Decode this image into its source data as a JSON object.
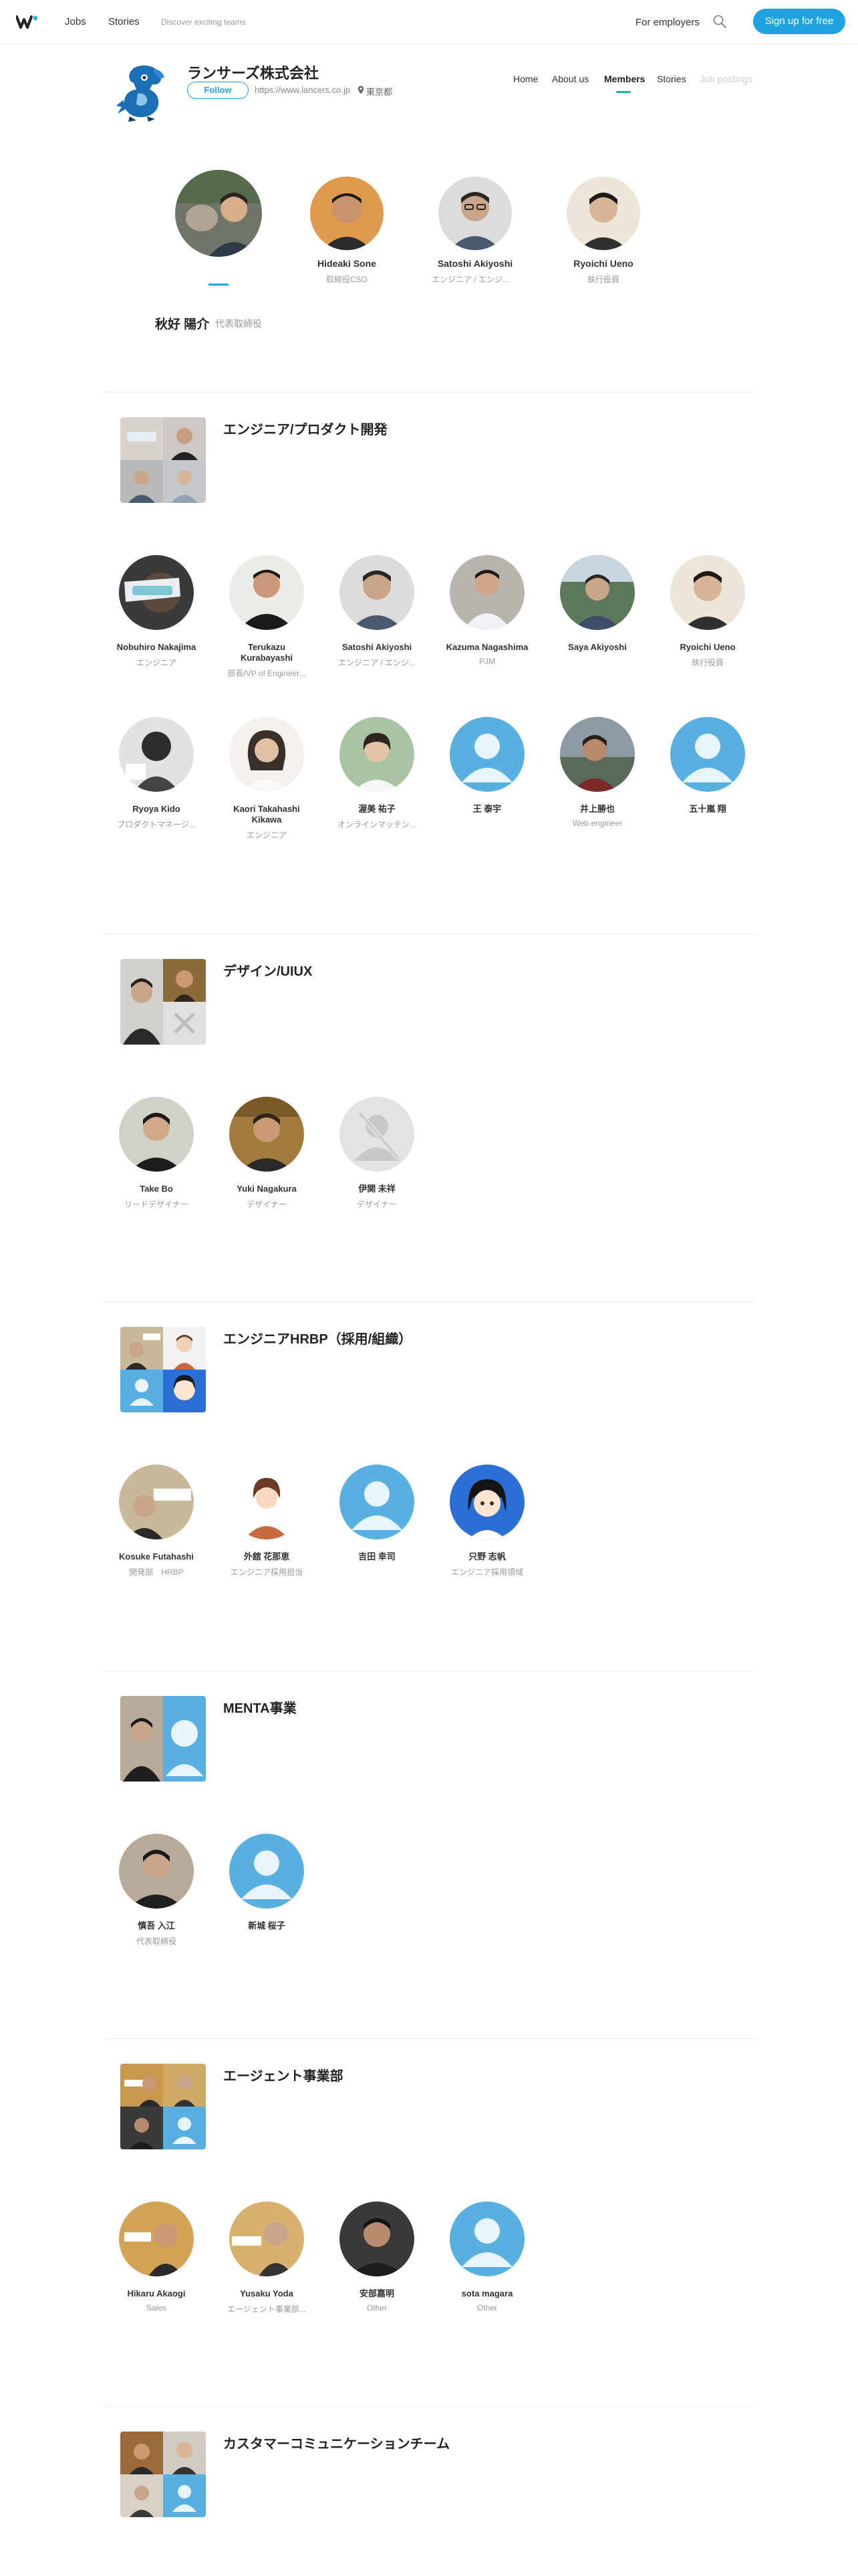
{
  "nav": {
    "jobs": "Jobs",
    "stories": "Stories",
    "tagline": "Discover exciting teams",
    "employers": "For employers",
    "signup": "Sign up for free"
  },
  "company": {
    "name": "ランサーズ株式会社",
    "follow": "Follow",
    "url": "https://www.lancers.co.jp",
    "location": "東京都",
    "tabs": [
      "Home",
      "About us",
      "Members",
      "Stories",
      "Job postings"
    ]
  },
  "featured": {
    "members": [
      {
        "name": "",
        "role": ""
      },
      {
        "name": "Hideaki Sone",
        "role": "取締役CSO"
      },
      {
        "name": "Satoshi Akiyoshi",
        "role": "エンジニア / エンジニアリ..."
      },
      {
        "name": "Ryoichi Ueno",
        "role": "執行役員"
      }
    ],
    "selected_name": "秋好 陽介",
    "selected_role": "代表取締役"
  },
  "sections": [
    {
      "title": "エンジニア/プロダクト開発",
      "members": [
        {
          "name": "Nobuhiro Nakajima",
          "role": "エンジニア"
        },
        {
          "name": "Terukazu Kurabayashi",
          "role": "部長/VP of Engineer..."
        },
        {
          "name": "Satoshi Akiyoshi",
          "role": "エンジニア / エンジ..."
        },
        {
          "name": "Kazuma Nagashima",
          "role": "PJM"
        },
        {
          "name": "Saya Akiyoshi",
          "role": ""
        },
        {
          "name": "Ryoichi Ueno",
          "role": "執行役員"
        },
        {
          "name": "Ryoya Kido",
          "role": "プロダクトマネージ..."
        },
        {
          "name": "Kaori Takahashi Kikawa",
          "role": "エンジニア"
        },
        {
          "name": "渥美 祐子",
          "role": "オンラインマッチン..."
        },
        {
          "name": "王 泰宇",
          "role": ""
        },
        {
          "name": "井上勝也",
          "role": "Web engineer"
        },
        {
          "name": "五十嵐 翔",
          "role": ""
        }
      ]
    },
    {
      "title": "デザイン/UIUX",
      "members": [
        {
          "name": "Take Bo",
          "role": "リードデザイナー"
        },
        {
          "name": "Yuki Nagakura",
          "role": "デザイナー"
        },
        {
          "name": "伊関 未祥",
          "role": "デザイナー"
        }
      ]
    },
    {
      "title": "エンジニアHRBP（採用/組織）",
      "members": [
        {
          "name": "Kosuke Futahashi",
          "role": "開発部　HRBP"
        },
        {
          "name": "外舘 花那恵",
          "role": "エンジニア採用担当"
        },
        {
          "name": "吉田 幸司",
          "role": ""
        },
        {
          "name": "只野 志帆",
          "role": "エンジニア採用領域"
        }
      ]
    },
    {
      "title": "MENTA事業",
      "members": [
        {
          "name": "慎吾 入江",
          "role": "代表取締役"
        },
        {
          "name": "新城 桜子",
          "role": ""
        }
      ]
    },
    {
      "title": "エージェント事業部",
      "members": [
        {
          "name": "Hikaru Akaogi",
          "role": "Sales"
        },
        {
          "name": "Yusaku Yoda",
          "role": "エージェント事業部..."
        },
        {
          "name": "安部嘉明",
          "role": "Other"
        },
        {
          "name": "sota magara",
          "role": "Other"
        }
      ]
    },
    {
      "title": "カスタマーコミュニケーションチーム",
      "members": []
    }
  ]
}
